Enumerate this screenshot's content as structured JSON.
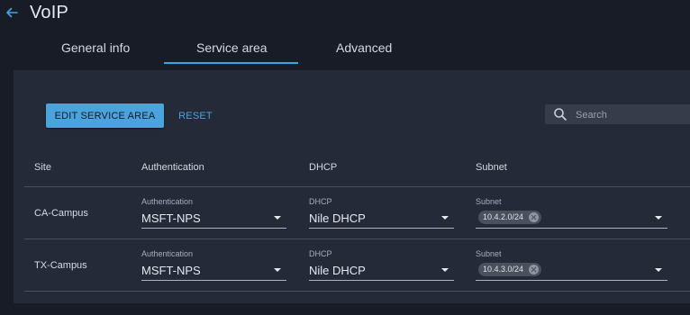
{
  "header": {
    "title": "VoIP",
    "tabs": [
      {
        "label": "General info"
      },
      {
        "label": "Service area"
      },
      {
        "label": "Advanced"
      }
    ],
    "active_tab": "Service area"
  },
  "toolbar": {
    "edit_label": "EDIT SERVICE AREA",
    "reset_label": "RESET",
    "search_placeholder": "Search"
  },
  "table": {
    "columns": [
      "Site",
      "Authentication",
      "DHCP",
      "Subnet"
    ],
    "rows": [
      {
        "site": "CA-Campus",
        "auth_label": "Authentication",
        "auth_value": "MSFT-NPS",
        "dhcp_label": "DHCP",
        "dhcp_value": "Nile DHCP",
        "subnet_label": "Subnet",
        "subnet_chip": "10.4.2.0/24"
      },
      {
        "site": "TX-Campus",
        "auth_label": "Authentication",
        "auth_value": "MSFT-NPS",
        "dhcp_label": "DHCP",
        "dhcp_value": "Nile DHCP",
        "subnet_label": "Subnet",
        "subnet_chip": "10.4.3.0/24"
      }
    ]
  },
  "colors": {
    "background": "#181c26",
    "panel": "#242a37",
    "accent": "#4aa3dc",
    "tab_underline": "#3aa6e0"
  },
  "icons": [
    "back-arrow-icon",
    "search-icon",
    "caret-down-icon",
    "chip-close-icon"
  ]
}
